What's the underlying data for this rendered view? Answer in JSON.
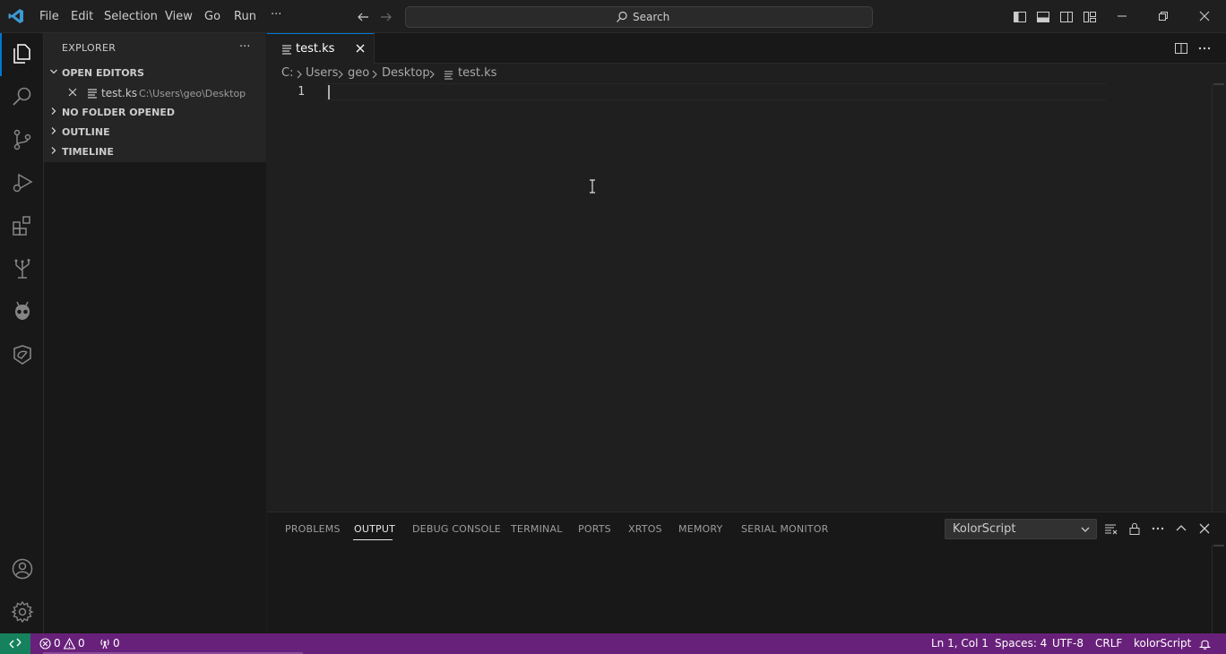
{
  "titlebar": {
    "menu": [
      "File",
      "Edit",
      "Selection",
      "View",
      "Go",
      "Run",
      "···"
    ],
    "search_placeholder": "Search"
  },
  "sidebar": {
    "title": "EXPLORER",
    "more": "···",
    "sections": {
      "open_editors": "OPEN EDITORS",
      "no_folder": "NO FOLDER OPENED",
      "outline": "OUTLINE",
      "timeline": "TIMELINE"
    },
    "open_editor": {
      "name": "test.ks",
      "path": "C:\\Users\\geo\\Desktop"
    }
  },
  "editor": {
    "tab_label": "test.ks",
    "breadcrumb": [
      "C:",
      "Users",
      "geo",
      "Desktop",
      "test.ks"
    ],
    "line_number": "1"
  },
  "panel": {
    "tabs": [
      "PROBLEMS",
      "OUTPUT",
      "DEBUG CONSOLE",
      "TERMINAL",
      "PORTS",
      "XRTOS",
      "MEMORY",
      "SERIAL MONITOR"
    ],
    "active_tab": "OUTPUT",
    "channel": "KolorScript"
  },
  "statusbar": {
    "errors": "0",
    "warnings": "0",
    "ports": "0",
    "position": "Ln 1, Col 1",
    "spaces": "Spaces: 4",
    "encoding": "UTF-8",
    "eol": "CRLF",
    "language": "kolorScript"
  },
  "colors": {
    "accent": "#0078d4",
    "statusbar": "#68217a",
    "remote": "#16825d",
    "logo": "#3c99d4"
  }
}
